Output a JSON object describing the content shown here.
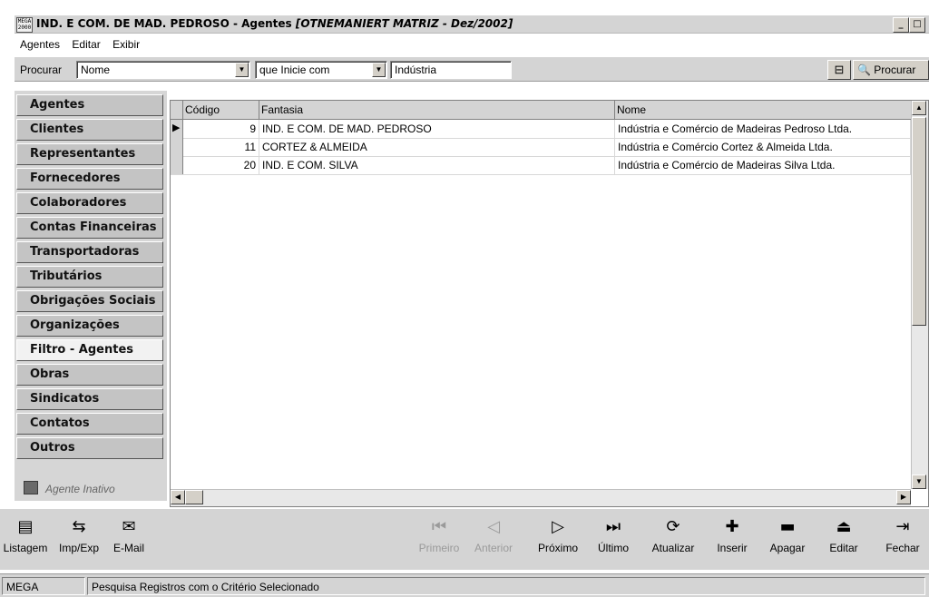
{
  "window": {
    "title_main": "IND. E COM. DE MAD. PEDROSO -  Agentes ",
    "title_context": "[OTNEMANIERT MATRIZ - Dez/2002]",
    "app_icon_text": "MEGA 2000"
  },
  "menu": [
    "Agentes",
    "Editar",
    "Exibir"
  ],
  "search": {
    "label": "Procurar",
    "field_value": "Nome",
    "condition_value": "que Inicie com",
    "term_value": "Indústria",
    "search_button": "Procurar"
  },
  "sidebar": {
    "items": [
      {
        "label": "Agentes"
      },
      {
        "label": "Clientes"
      },
      {
        "label": "Representantes"
      },
      {
        "label": "Fornecedores"
      },
      {
        "label": "Colaboradores"
      },
      {
        "label": "Contas Financeiras"
      },
      {
        "label": "Transportadoras"
      },
      {
        "label": "Tributários"
      },
      {
        "label": "Obrigações Sociais"
      },
      {
        "label": "Organizações"
      },
      {
        "label": "Filtro - Agentes"
      },
      {
        "label": "Obras"
      },
      {
        "label": "Sindicatos"
      },
      {
        "label": "Contatos"
      },
      {
        "label": "Outros"
      }
    ],
    "active": "Filtro - Agentes",
    "legend": "Agente Inativo"
  },
  "grid": {
    "columns": [
      "Código",
      "Fantasia",
      "Nome"
    ],
    "rows": [
      {
        "codigo": "9",
        "fantasia": "IND. E COM. DE MAD. PEDROSO",
        "nome": "Indústria e Comércio de Madeiras Pedroso Ltda."
      },
      {
        "codigo": "11",
        "fantasia": "CORTEZ & ALMEIDA",
        "nome": "Indústria e Comércio Cortez & Almeida Ltda."
      },
      {
        "codigo": "20",
        "fantasia": "IND. E COM. SILVA",
        "nome": "Indústria e Comércio de Madeiras Silva Ltda."
      }
    ]
  },
  "toolbar": {
    "listagem": "Listagem",
    "impexp": "Imp/Exp",
    "email": "E-Mail",
    "primeiro": "Primeiro",
    "anterior": "Anterior",
    "proximo": "Próximo",
    "ultimo": "Último",
    "atualizar": "Atualizar",
    "inserir": "Inserir",
    "apagar": "Apagar",
    "editar": "Editar",
    "fechar": "Fechar"
  },
  "status": {
    "module": "MEGA",
    "message": "Pesquisa Registros com o Critério Selecionado"
  }
}
